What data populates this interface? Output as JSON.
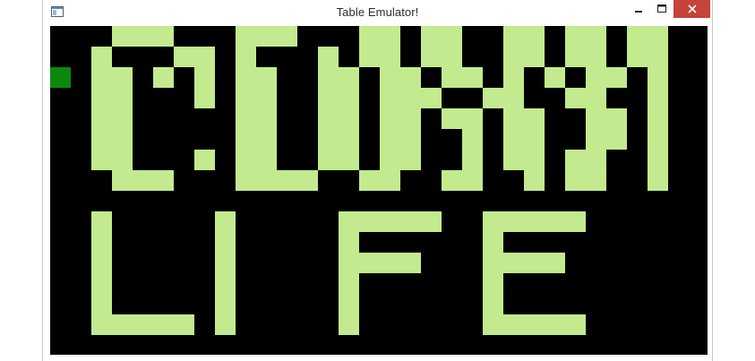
{
  "window": {
    "title": "Table Emulator!"
  },
  "icons": {
    "app": "app-window-icon",
    "minimize": "minimize-icon",
    "maximize": "maximize-icon",
    "close": "close-icon"
  },
  "colors": {
    "board_background": "#000000",
    "live_cell": "#c3ea8f",
    "cursor_cell": "#0a8a0a",
    "close_button": "#c7423b"
  },
  "board": {
    "cursor": [
      0,
      2
    ],
    "rows": [
      "...###...###...##.##..##.##.##",
      "..#...##.#...#.##.##..##.##.##",
      "..##.#.#.##..##.##.##.#.#.##.#",
      "..##...#.##..##.###..##..##..#",
      "..##.....##..##.##.##.##..##.#",
      "..##.....##..##.##..#.##..##.#",
      "..##...#.##..##.##..#.##.##..#",
      "...###...####..##..##..#.##..#",
      "..............................",
      "..#.....#.....#####..#####....",
      "..#.....#.....#......#........",
      "..#.....#.....####...####.....",
      "..#.....#.....#......#........",
      "..#.....#.....#......#........",
      "..#####.#.....#......#####....",
      ".............................."
    ]
  }
}
